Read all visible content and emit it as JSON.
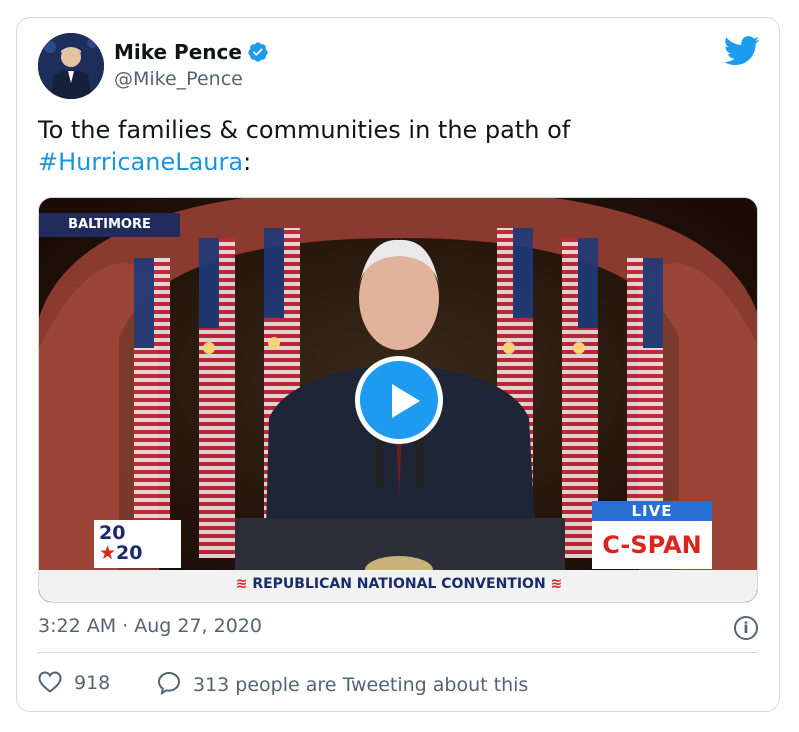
{
  "author": {
    "name": "Mike Pence",
    "handle": "@Mike_Pence",
    "verified_icon": "verified-badge-icon",
    "avatar_icon": "avatar-photo"
  },
  "tweet": {
    "text_before": "To the families & communities in the path of",
    "hashtag": "#HurricaneLaura",
    "text_after": ":",
    "timestamp": "3:22 AM · Aug 27, 2020"
  },
  "media": {
    "location_label": "BALTIMORE",
    "live_label": "LIVE",
    "network": "C-SPAN",
    "logo_top": "20",
    "logo_bottom": "20",
    "banner": "REPUBLICAN NATIONAL CONVENTION",
    "play_icon": "play-icon"
  },
  "engagement": {
    "likes": "918",
    "replies_text": "313 people are Tweeting about this"
  },
  "colors": {
    "hashtag": "#1b95e0",
    "twitter_blue": "#1d9bf0",
    "secondary_text": "#536471"
  }
}
